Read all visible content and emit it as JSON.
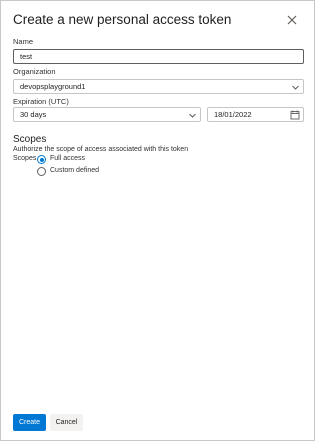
{
  "dialog": {
    "title": "Create a new personal access token",
    "close_icon": "close-icon"
  },
  "form": {
    "name": {
      "label": "Name",
      "value": "test"
    },
    "organization": {
      "label": "Organization",
      "value": "devopsplayground1",
      "icon": "chevron-down-icon"
    },
    "expiration": {
      "label": "Expiration (UTC)",
      "value": "30 days",
      "date": "18/01/2022",
      "icon": "chevron-down-icon",
      "date_icon": "calendar-icon"
    }
  },
  "scopes": {
    "title": "Scopes",
    "description": "Authorize the scope of access associated with this token",
    "label": "Scopes",
    "options": [
      {
        "label": "Full access",
        "checked": true
      },
      {
        "label": "Custom defined",
        "checked": false
      }
    ]
  },
  "actions": {
    "create_label": "Create",
    "cancel_label": "Cancel"
  },
  "colors": {
    "accent": "#0078d4",
    "border": "#8a8886"
  }
}
